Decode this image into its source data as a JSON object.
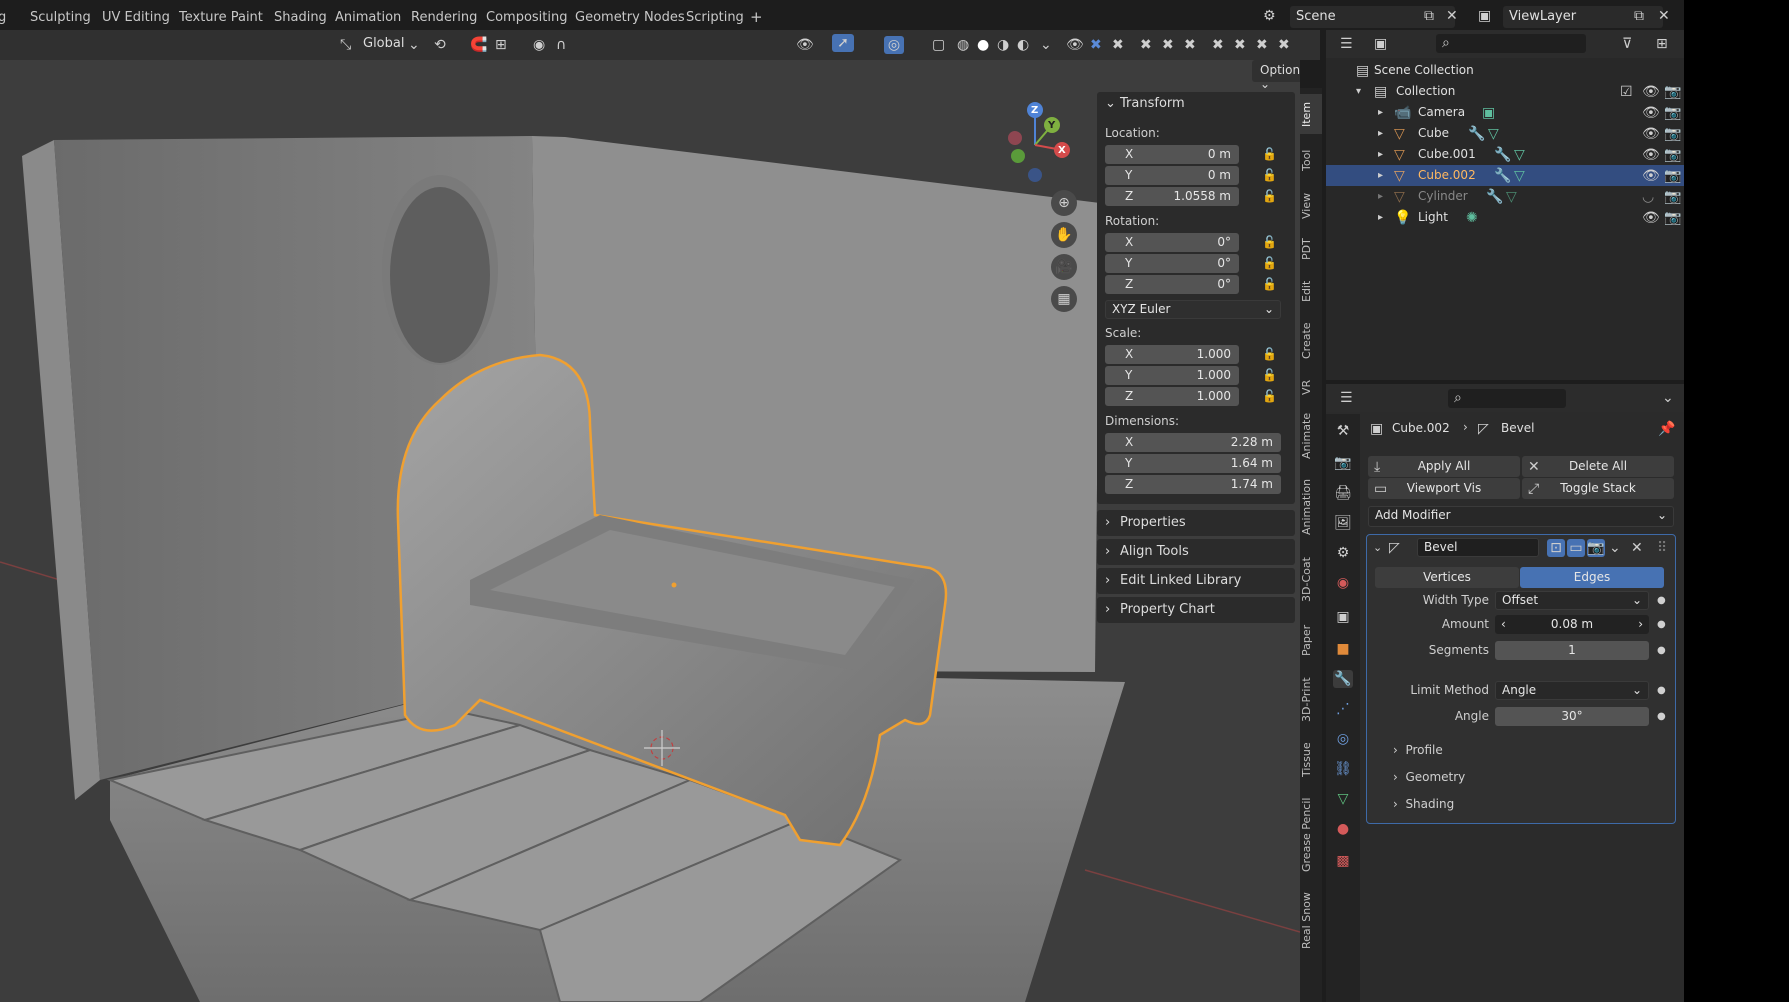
{
  "workspaces": [
    "Sculpting",
    "UV Editing",
    "Texture Paint",
    "Shading",
    "Animation",
    "Rendering",
    "Compositing",
    "Geometry Nodes",
    "Scripting"
  ],
  "workspace_add": "+",
  "scene": "Scene",
  "view_layer": "ViewLayer",
  "viewport": {
    "orientation": "Global",
    "options": "Options"
  },
  "gizmo": {
    "z": "Z",
    "y": "Y",
    "x": "X"
  },
  "npanel": {
    "transform": "Transform",
    "location_label": "Location:",
    "location": [
      {
        "axis": "X",
        "value": "0 m"
      },
      {
        "axis": "Y",
        "value": "0 m"
      },
      {
        "axis": "Z",
        "value": "1.0558 m"
      }
    ],
    "rotation_label": "Rotation:",
    "rotation": [
      {
        "axis": "X",
        "value": "0°"
      },
      {
        "axis": "Y",
        "value": "0°"
      },
      {
        "axis": "Z",
        "value": "0°"
      }
    ],
    "rotation_mode": "XYZ Euler",
    "scale_label": "Scale:",
    "scale": [
      {
        "axis": "X",
        "value": "1.000"
      },
      {
        "axis": "Y",
        "value": "1.000"
      },
      {
        "axis": "Z",
        "value": "1.000"
      }
    ],
    "dimensions_label": "Dimensions:",
    "dimensions": [
      {
        "axis": "X",
        "value": "2.28 m"
      },
      {
        "axis": "Y",
        "value": "1.64 m"
      },
      {
        "axis": "Z",
        "value": "1.74 m"
      }
    ],
    "subpanels": [
      "Properties",
      "Align Tools",
      "Edit Linked Library",
      "Property Chart"
    ]
  },
  "sidebar_tabs": [
    "Item",
    "Tool",
    "View",
    "PDT",
    "Edit",
    "Create",
    "VR",
    "Animate",
    "Animation",
    "3D-Coat",
    "Paper",
    "3D-Print",
    "Tissue",
    "Grease Pencil",
    "Real Snow"
  ],
  "outliner": {
    "root": "Scene Collection",
    "collection": "Collection",
    "items": [
      {
        "name": "Camera",
        "selected": false,
        "dim": false
      },
      {
        "name": "Cube",
        "selected": false,
        "dim": false
      },
      {
        "name": "Cube.001",
        "selected": false,
        "dim": false
      },
      {
        "name": "Cube.002",
        "selected": true,
        "dim": false
      },
      {
        "name": "Cylinder",
        "selected": false,
        "dim": true
      },
      {
        "name": "Light",
        "selected": false,
        "dim": false
      }
    ]
  },
  "properties": {
    "object": "Cube.002",
    "modifier_crumb": "Bevel",
    "apply_all": "Apply All",
    "delete_all": "Delete All",
    "viewport_vis": "Viewport Vis",
    "toggle_stack": "Toggle Stack",
    "add_modifier": "Add Modifier",
    "modifier_name": "Bevel",
    "affect_vertices": "Vertices",
    "affect_edges": "Edges",
    "width_type_label": "Width Type",
    "width_type": "Offset",
    "amount_label": "Amount",
    "amount": "0.08 m",
    "segments_label": "Segments",
    "segments": "1",
    "limit_method_label": "Limit Method",
    "limit_method": "Angle",
    "angle_label": "Angle",
    "angle": "30°",
    "subpanels": [
      "Profile",
      "Geometry",
      "Shading"
    ]
  },
  "colors": {
    "selection_orange": "#f0a030",
    "active_blue": "#4772b3",
    "header": "#1d1d1d"
  }
}
